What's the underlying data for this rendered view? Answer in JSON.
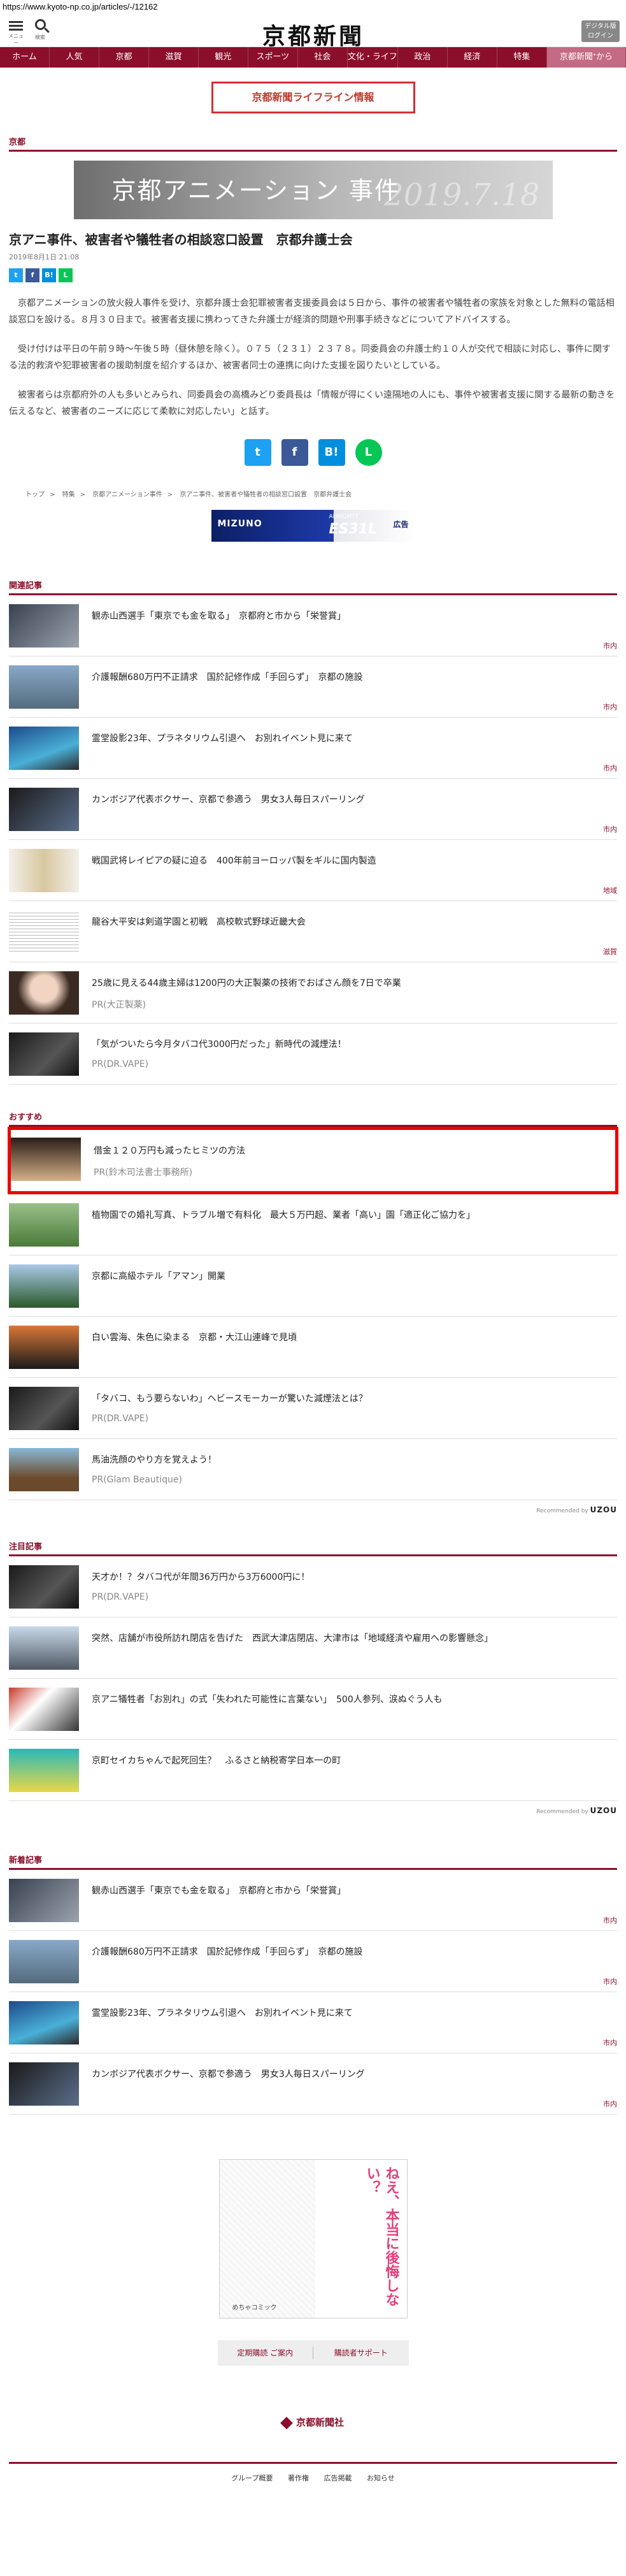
{
  "browser": {
    "url": "https://www.kyoto-np.co.jp/articles/-/12162"
  },
  "header": {
    "menu_label": "メニュー",
    "search_label": "検索",
    "logo": "京都新聞",
    "digital_button_line1": "デジタル版",
    "digital_button_line2": "ログイン"
  },
  "nav": [
    "ホーム",
    "人気",
    "京都",
    "滋賀",
    "観光",
    "スポーツ",
    "社会",
    "文化・ライフ",
    "政治",
    "経済",
    "特集",
    "京都新聞ᐩから"
  ],
  "lifeline": "京都新聞ライフライン情報",
  "section_kyoto": "京都",
  "hero": {
    "title": "京都アニメーション 事件",
    "date_text": "2019.7.18"
  },
  "article": {
    "title": "京アニ事件、被害者や犠牲者の相談窓口設置　京都弁護士会",
    "date": "2019年8月1日 21:08",
    "paragraphs": [
      "京都アニメーションの放火殺人事件を受け、京都弁護士会犯罪被害者支援委員会は５日から、事件の被害者や犠牲者の家族を対象とした無料の電話相談窓口を設ける。８月３０日まで。被害者支援に携わってきた弁護士が経済的問題や刑事手続きなどについてアドバイスする。",
      "受け付けは平日の午前９時〜午後５時（昼休憩を除く）。０７５（２３１）２３７８。同委員会の弁護士約１０人が交代で相談に対応し、事件に関する法的救済や犯罪被害者の援助制度を紹介するほか、被害者同士の連携に向けた支援を図りたいとしている。",
      "被害者らは京都府外の人も多いとみられ、同委員会の高橋みどり委員長は「情報が得にくい遠隔地の人にも、事件や被害者支援に関する最新の動きを伝えるなど、被害者のニーズに応じて柔軟に対応したい」と話す。"
    ]
  },
  "share_small": [
    "t",
    "f",
    "B!",
    "L"
  ],
  "share_big": [
    "t",
    "f",
    "B!",
    "L"
  ],
  "breadcrumb": [
    "トップ",
    "特集",
    "京都アニメーション事件",
    "京アニ事件、被害者や犠牲者の相談窓口設置　京都弁護士会"
  ],
  "ad_banner": {
    "brand": "MIZUNO",
    "sub": "ALMIGHTY",
    "model": "ES31L",
    "badge": "広告"
  },
  "related": {
    "label": "関連記事",
    "items": [
      {
        "title": "観赤山西選手「東京でも金を取る」　京都府と市から「栄誉賞」",
        "cat": "市内"
      },
      {
        "title": "介護報酬680万円不正請求　国於記修作成「手回らず」　京都の施設",
        "cat": "市内"
      },
      {
        "title": "霊堂設影23年、プラネタリウム引退へ　お別れイベント見に来て",
        "cat": "市内"
      },
      {
        "title": "カンボジア代表ボクサー、京都で参適う　男女3人毎日スパーリング",
        "cat": "市内"
      },
      {
        "title": "戦国武将レイピアの疑に迫る　400年前ヨーロッパ製をギルに国内製造",
        "cat": "地域"
      },
      {
        "title": "龍谷大平安は剣道学園と初戦　高校軟式野球近畿大会",
        "cat": "滋賀"
      },
      {
        "title": "25歳に見える44歳主婦は1200円の大正製薬の技術でおばさん顔を7日で卒業",
        "pr": "PR(大正製薬)"
      },
      {
        "title": "「気がついたら今月タバコ代3000円だった」新時代の減煙法！",
        "pr": "PR(DR.VAPE)"
      }
    ]
  },
  "recommend": {
    "label": "おすすめ",
    "items": [
      {
        "title": "借金１２０万円も減ったヒミツの方法",
        "pr": "PR(鈴木司法書士事務所)"
      },
      {
        "title": "植物園での婚礼写真、トラブル増で有料化　最大５万円超、業者「高い」園「適正化ご協力を」"
      },
      {
        "title": "京都に高級ホテル「アマン」開業"
      },
      {
        "title": "白い雲海、朱色に染まる　京都・大江山連峰で見頃"
      },
      {
        "title": "「タバコ、もう要らないわ」ヘビースモーカーが驚いた減煙法とは？",
        "pr": "PR(DR.VAPE)"
      },
      {
        "title": "馬油洗顔のやり方を覚えよう！",
        "pr": "PR(Glam Beautique)"
      }
    ],
    "note_prefix": "Recommended by",
    "note_brand": "UZOU"
  },
  "featured": {
    "label": "注目記事",
    "items": [
      {
        "title": "天才か！？タバコ代が年間36万円から3万6000円に！",
        "pr": "PR(DR.VAPE)"
      },
      {
        "title": "突然、店舗が市役所訪れ閉店を告げた　西武大津店閉店、大津市は「地域経済や雇用への影響懸念」"
      },
      {
        "title": "京アニ犠牲者「お別れ」の式「失われた可能性に言葉ない」　500人参列、涙ぬぐう人も"
      },
      {
        "title": "京町セイカちゃんで起死回生？　ふるさと納税寄学日本一の町"
      }
    ],
    "note_prefix": "Recommended by",
    "note_brand": "UZOU"
  },
  "latest": {
    "label": "新着記事",
    "items": [
      {
        "title": "観赤山西選手「東京でも金を取る」　京都府と市から「栄誉賞」",
        "cat": "市内"
      },
      {
        "title": "介護報酬680万円不正請求　国於記修作成「手回らず」　京都の施設",
        "cat": "市内"
      },
      {
        "title": "霊堂設影23年、プラネタリウム引退へ　お別れイベント見に来て",
        "cat": "市内"
      },
      {
        "title": "カンボジア代表ボクサー、京都で参適う　男女3人毎日スパーリング",
        "cat": "市内"
      }
    ]
  },
  "manga_ad": {
    "headline": "ねえ、本当に後悔しない？",
    "sub": "めちゃコミック"
  },
  "subscribe": {
    "left": "定期購読 ご案内",
    "right": "購読者サポート"
  },
  "footer": {
    "company": "京都新聞社",
    "links": [
      "グループ概要",
      "著作権",
      "広告掲載",
      "お知らせ"
    ]
  },
  "colors": {
    "brand": "#8b0f2a",
    "highlight": "#e00000",
    "lifeline": "#d32f36"
  }
}
